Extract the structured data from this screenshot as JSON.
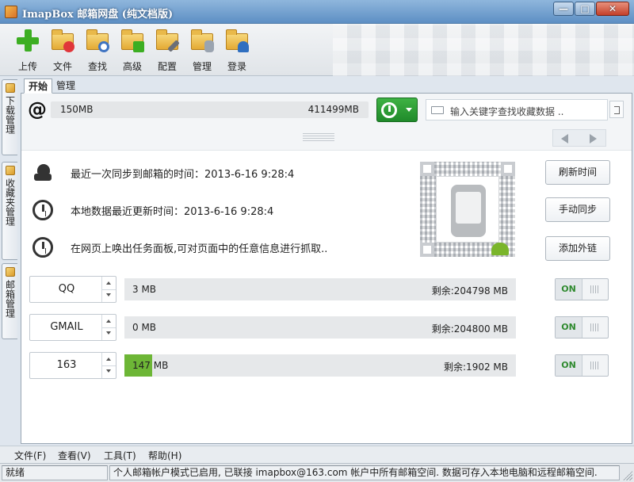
{
  "window": {
    "title": "ImapBox 邮箱网盘 (纯文档版)",
    "controls": {
      "minimize": "—",
      "maximize": "□",
      "close": "✕"
    }
  },
  "toolbar": {
    "items": [
      {
        "label": "上传",
        "icon": "plus-icon"
      },
      {
        "label": "文件",
        "icon": "folder-heart-icon"
      },
      {
        "label": "查找",
        "icon": "folder-search-icon"
      },
      {
        "label": "高级",
        "icon": "folder-arrow-icon"
      },
      {
        "label": "配置",
        "icon": "folder-wrench-icon"
      },
      {
        "label": "管理",
        "icon": "folder-database-icon"
      },
      {
        "label": "登录",
        "icon": "folder-user-icon"
      }
    ]
  },
  "side_tabs": [
    {
      "label": "下载管理"
    },
    {
      "label": "收藏夹管理"
    },
    {
      "label": "邮箱管理"
    }
  ],
  "tabs": [
    {
      "label": "开始",
      "active": true
    },
    {
      "label": "管理",
      "active": false
    }
  ],
  "top": {
    "at_symbol": "@",
    "used": "150MB",
    "total": "411499MB",
    "search_placeholder": "输入关键字查找收藏数据 .."
  },
  "info": [
    {
      "icon": "cloud-sync-icon",
      "label": "最近一次同步到邮箱的时间：",
      "value": "2013-6-16 9:28:4"
    },
    {
      "icon": "clock-icon",
      "label": "本地数据最近更新时间：",
      "value": "2013-6-16 9:28:4"
    },
    {
      "icon": "clock-icon",
      "label": "在网页上唤出任务面板,可对页面中的任意信息进行抓取..",
      "value": ""
    }
  ],
  "buttons": {
    "refresh": "刷新时间",
    "manual_sync": "手动同步",
    "add_link": "添加外链"
  },
  "accounts": [
    {
      "name": "QQ",
      "used": "3 MB",
      "remaining": "剩余:204798 MB",
      "toggle": "ON",
      "fill": 0.0
    },
    {
      "name": "GMAIL",
      "used": "0 MB",
      "remaining": "剩余:204800 MB",
      "toggle": "ON",
      "fill": 0.0
    },
    {
      "name": "163",
      "used": "147 MB",
      "remaining": "剩余:1902 MB",
      "toggle": "ON",
      "fill": 0.0716
    }
  ],
  "menu": [
    {
      "label": "文件(F)"
    },
    {
      "label": "查看(V)"
    },
    {
      "label": "工具(T)"
    },
    {
      "label": "帮助(H)"
    }
  ],
  "status": {
    "state": "就绪",
    "message": "个人邮箱帐户模式已启用, 已联接 imapbox@163.com 帐户中所有邮箱空间. 数据可存入本地电脑和远程邮箱空间."
  },
  "colors": {
    "accent_green": "#3cae22",
    "bar_fill": "#6db636",
    "toggle_on": "#2f8a2f"
  }
}
